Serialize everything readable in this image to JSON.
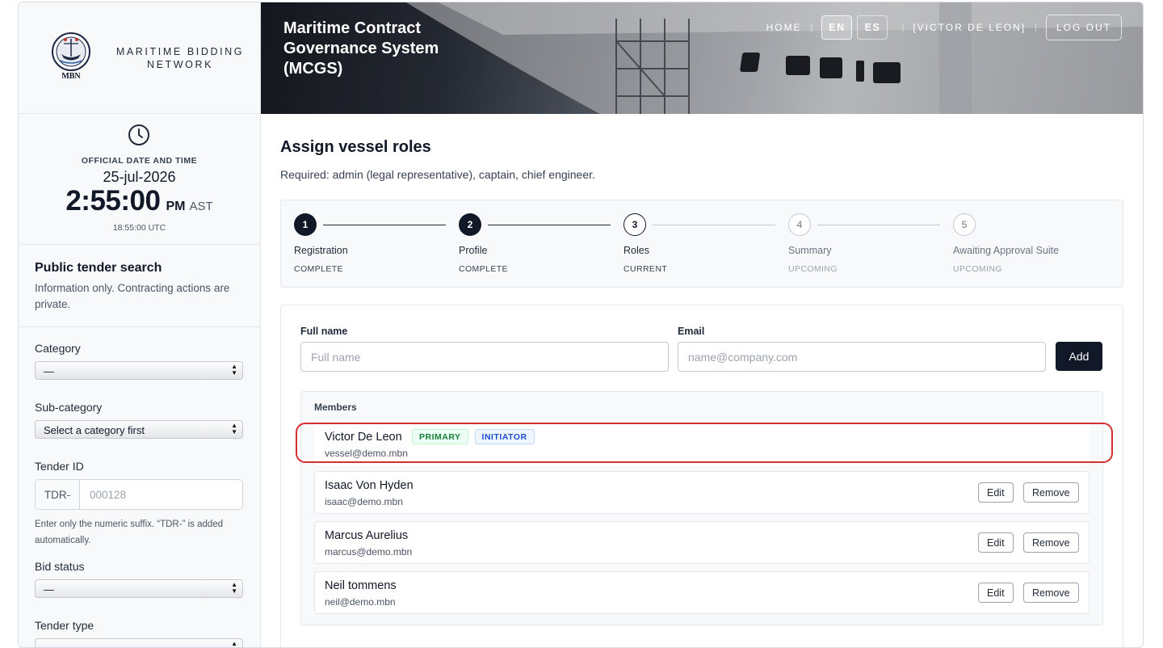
{
  "brand": {
    "logo_text": "MBN",
    "name": "MARITIME BIDDING NETWORK"
  },
  "header": {
    "title": "Maritime Contract Governance System (MCGS)",
    "nav": {
      "home": "HOME",
      "lang_en": "EN",
      "lang_es": "ES",
      "user": "[VICTOR DE LEON]",
      "logout": "LOG OUT",
      "separator": "|"
    }
  },
  "clock": {
    "label": "OFFICIAL DATE AND TIME",
    "date": "25-jul-2026",
    "time": "2:55:00",
    "ampm": "PM",
    "tz": "AST",
    "utc": "18:55:00 UTC"
  },
  "search": {
    "title": "Public tender search",
    "subtitle": "Information only. Contracting actions are private.",
    "category": {
      "label": "Category",
      "value": "—"
    },
    "subcategory": {
      "label": "Sub-category",
      "value": "Select a category first"
    },
    "tender_id": {
      "label": "Tender ID",
      "prefix": "TDR-",
      "placeholder": "000128",
      "help": "Enter only the numeric suffix. “TDR-” is added automatically."
    },
    "bid_status": {
      "label": "Bid status",
      "value": "—"
    },
    "tender_type": {
      "label": "Tender type",
      "value": "—"
    }
  },
  "main": {
    "title": "Assign vessel roles",
    "subtitle": "Required: admin (legal representative), captain, chief engineer.",
    "steps": [
      {
        "num": "1",
        "name": "Registration",
        "status": "COMPLETE"
      },
      {
        "num": "2",
        "name": "Profile",
        "status": "COMPLETE"
      },
      {
        "num": "3",
        "name": "Roles",
        "status": "CURRENT"
      },
      {
        "num": "4",
        "name": "Summary",
        "status": "UPCOMING"
      },
      {
        "num": "5",
        "name": "Awaiting Approval Suite",
        "status": "UPCOMING"
      }
    ],
    "form": {
      "name_label": "Full name",
      "name_placeholder": "Full name",
      "email_label": "Email",
      "email_placeholder": "name@company.com",
      "add": "Add"
    },
    "members_title": "Members",
    "members": [
      {
        "name": "Victor De Leon",
        "email": "vessel@demo.mbn",
        "badges": [
          "PRIMARY",
          "INITIATOR"
        ]
      },
      {
        "name": "Isaac Von Hyden",
        "email": "isaac@demo.mbn",
        "edit": "Edit",
        "remove": "Remove"
      },
      {
        "name": "Marcus Aurelius",
        "email": "marcus@demo.mbn",
        "edit": "Edit",
        "remove": "Remove"
      },
      {
        "name": "Neil tommens",
        "email": "neil@demo.mbn",
        "edit": "Edit",
        "remove": "Remove"
      }
    ]
  },
  "colors": {
    "accent": "#111827",
    "highlight": "#d32f2f",
    "primary_badge": "#15803d",
    "initiator_badge": "#1d4ed8"
  }
}
